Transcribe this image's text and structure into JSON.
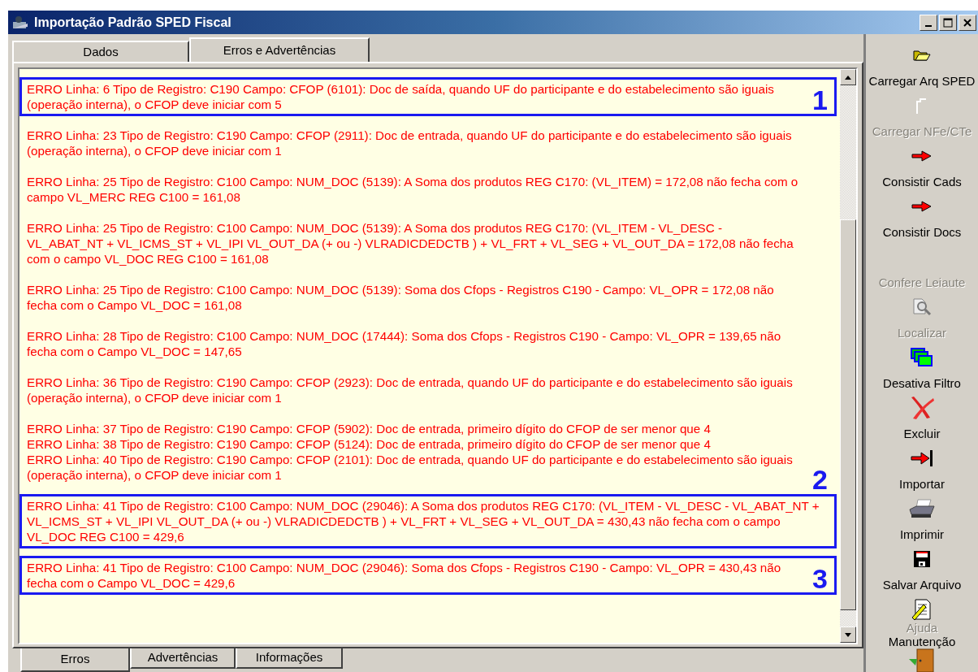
{
  "window": {
    "title": "Importação Padrão SPED Fiscal"
  },
  "tabs": [
    {
      "label": "Dados",
      "selected": false
    },
    {
      "label": "Erros e Advertências",
      "selected": true
    }
  ],
  "messages": [
    {
      "lines": [
        "ERRO Linha: 6 Tipo de Registro: C190 Campo: CFOP (6101): Doc de saída, quando UF do participante e do estabelecimento são iguais (operação interna), o CFOP deve iniciar com 5"
      ],
      "callout": {
        "number": "1",
        "kind": "inside"
      }
    },
    {
      "lines": [
        "ERRO Linha: 23 Tipo de Registro: C190 Campo: CFOP (2911): Doc de entrada, quando UF do participante e do estabelecimento são iguais (operação interna), o CFOP deve iniciar com 1"
      ]
    },
    {
      "lines": [
        "ERRO Linha: 25 Tipo de Registro: C100 Campo: NUM_DOC (5139): A Soma dos produtos REG C170: (VL_ITEM) = 172,08 não fecha com o campo VL_MERC REG C100 = 161,08"
      ]
    },
    {
      "lines": [
        "ERRO Linha: 25 Tipo de Registro: C100 Campo: NUM_DOC (5139): A Soma dos produtos REG C170: (VL_ITEM - VL_DESC - VL_ABAT_NT + VL_ICMS_ST + VL_IPI VL_OUT_DA (+ ou -) VLRADICDEDCTB ) + VL_FRT + VL_SEG + VL_OUT_DA = 172,08 não fecha com o campo VL_DOC REG C100 = 161,08"
      ]
    },
    {
      "lines": [
        "ERRO Linha: 25 Tipo de Registro: C100 Campo: NUM_DOC (5139): Soma dos Cfops - Registros C190 - Campo: VL_OPR = 172,08 não fecha com o Campo VL_DOC = 161,08"
      ]
    },
    {
      "lines": [
        "ERRO Linha: 28 Tipo de Registro: C100 Campo: NUM_DOC (17444): Soma dos Cfops - Registros C190 - Campo: VL_OPR = 139,65 não fecha com o Campo VL_DOC = 147,65"
      ]
    },
    {
      "lines": [
        "ERRO Linha: 36 Tipo de Registro: C190 Campo: CFOP (2923): Doc de entrada, quando UF do participante e do estabelecimento são iguais (operação interna), o CFOP deve iniciar com 1"
      ]
    },
    {
      "lines": [
        "ERRO Linha: 37 Tipo de Registro: C190 Campo: CFOP (5902): Doc de entrada, primeiro dígito do CFOP de ser menor que 4",
        "ERRO Linha: 38 Tipo de Registro: C190 Campo: CFOP (5124): Doc de entrada, primeiro dígito do CFOP de ser menor que 4",
        "ERRO Linha: 40 Tipo de Registro: C190 Campo: CFOP (2101): Doc de entrada, quando UF do participante e do estabelecimento são iguais (operação interna), o CFOP deve iniciar com 1"
      ]
    },
    {
      "lines": [
        "ERRO Linha: 41 Tipo de Registro: C100 Campo: NUM_DOC (29046): A Soma dos produtos REG C170: (VL_ITEM - VL_DESC - VL_ABAT_NT + VL_ICMS_ST + VL_IPI VL_OUT_DA (+ ou -) VLRADICDEDCTB ) + VL_FRT + VL_SEG + VL_OUT_DA = 430,43 não fecha com o campo VL_DOC REG C100 = 429,6"
      ],
      "callout": {
        "number": "2",
        "kind": "above"
      }
    },
    {
      "lines": [
        "ERRO Linha: 41 Tipo de Registro: C100 Campo: NUM_DOC (29046): Soma dos Cfops - Registros C190 - Campo: VL_OPR = 430,43 não fecha com o Campo VL_DOC = 429,6"
      ],
      "callout": {
        "number": "3",
        "kind": "inside"
      }
    }
  ],
  "bottom_tabs": [
    {
      "label": "Erros",
      "selected": true
    },
    {
      "label": "Advertências",
      "selected": false
    },
    {
      "label": "Informações",
      "selected": false
    }
  ],
  "toolbar": [
    {
      "label": "Carregar Arq SPED",
      "kind": "folder",
      "disabled": false
    },
    {
      "label": "Carregar NFe/CTe",
      "kind": "blank",
      "disabled": true
    },
    {
      "label": "Consistir Cads",
      "kind": "arrow",
      "disabled": false
    },
    {
      "label": "Consistir Docs",
      "kind": "arrow",
      "disabled": false
    },
    {
      "label": "Confere Leiaute",
      "kind": "none",
      "disabled": true
    },
    {
      "label": "Localizar",
      "kind": "find",
      "disabled": true
    },
    {
      "label": "Desativa Filtro",
      "kind": "stack",
      "disabled": false
    },
    {
      "label": "Excluir",
      "kind": "cross",
      "disabled": false
    },
    {
      "label": "Importar",
      "kind": "import",
      "disabled": false
    },
    {
      "label": "Imprimir",
      "kind": "printer",
      "disabled": false
    },
    {
      "label": "Salvar Arquivo",
      "kind": "floppy",
      "disabled": false
    },
    {
      "label": "Ajuda",
      "kind": "notepad",
      "disabled": true,
      "compact": true
    },
    {
      "label": "Manutenção",
      "kind": "door",
      "disabled": false,
      "compact": true
    }
  ]
}
